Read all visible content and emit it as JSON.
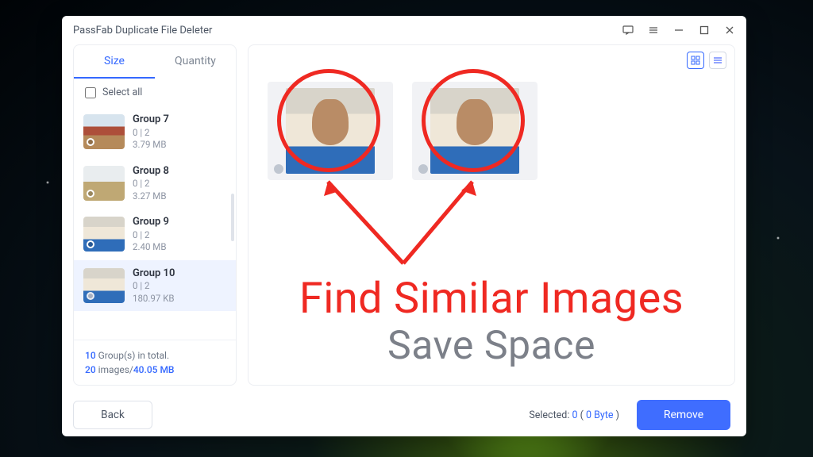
{
  "window": {
    "title": "PassFab Duplicate File Deleter"
  },
  "sidebar": {
    "tabs": {
      "size": "Size",
      "quantity": "Quantity"
    },
    "select_all": "Select all",
    "groups": [
      {
        "name": "Group 7",
        "stats": "0 | 2",
        "size": "3.79 MB"
      },
      {
        "name": "Group 8",
        "stats": "0 | 2",
        "size": "3.27 MB"
      },
      {
        "name": "Group 9",
        "stats": "0 | 2",
        "size": "2.40 MB"
      },
      {
        "name": "Group 10",
        "stats": "0 | 2",
        "size": "180.97 KB"
      }
    ],
    "totals": {
      "groups_count": "10",
      "groups_suffix": " Group(s) in total.",
      "images_count": "20",
      "images_mid": " images/",
      "total_size": "40.05 MB"
    }
  },
  "footer": {
    "back": "Back",
    "selected_label": "Selected: ",
    "selected_count": "0",
    "selected_mid": " ( ",
    "selected_size": "0 Byte",
    "selected_end": " )",
    "remove": "Remove"
  },
  "overlay": {
    "line1": "Find Similar Images",
    "line2": "Save Space"
  }
}
